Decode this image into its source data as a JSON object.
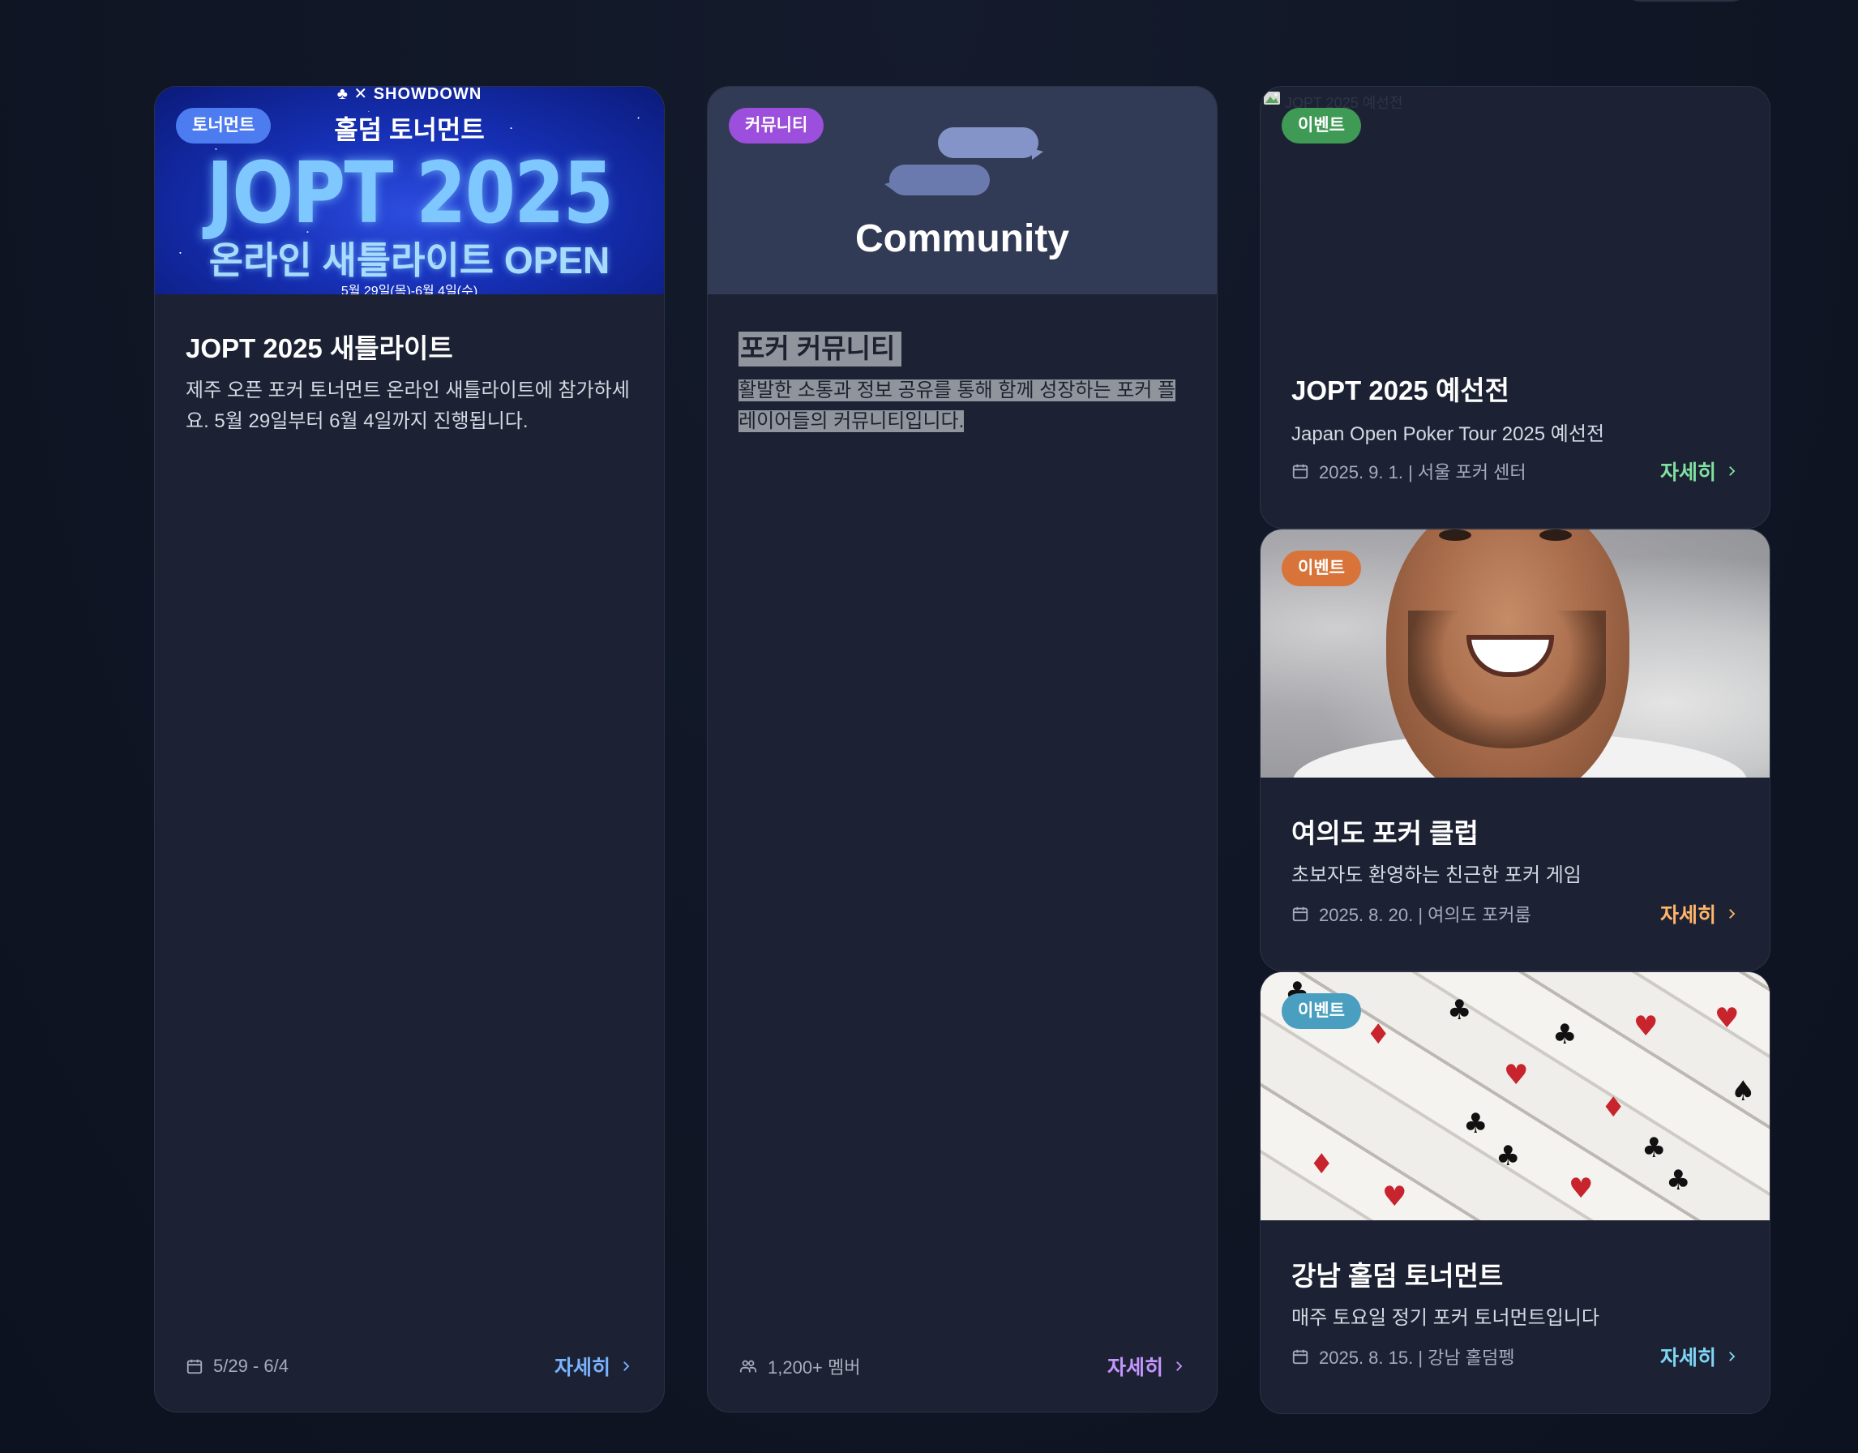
{
  "colors": {
    "tournament_badge": "#4d7cf0",
    "community_badge": "#9b4fdc",
    "event_badge_green": "#3f9a56",
    "event_badge_orange": "#d8743a",
    "event_badge_teal": "#4a9fc0",
    "more_blue": "#7ab3ff",
    "more_purple": "#c596ff",
    "more_green": "#7fe0a0",
    "more_orange": "#ffb56b",
    "more_cyan": "#7fd6f5"
  },
  "card_jopt": {
    "badge": "토너먼트",
    "banner": {
      "logo_text": "SHOWDOWN",
      "subtitle": "홀덤 토너먼트",
      "headline": "JOPT 2025",
      "tagline": "온라인 새틀라이트 OPEN",
      "date_line": "5월 29일(목)-6월 4일(수)"
    },
    "title": "JOPT 2025 새틀라이트",
    "description": "제주 오픈 포커 토너먼트 온라인 새틀라이트에 참가하세요. 5월 29일부터 6월 4일까지 진행됩니다.",
    "date": "5/29 - 6/4",
    "date_icon": "calendar-icon",
    "more": "자세히"
  },
  "card_community": {
    "badge": "커뮤니티",
    "banner_text": "Community",
    "title": "포커 커뮤니티",
    "description": "활발한 소통과 정보 공유를 통해 함께 성장하는 포커 플레이어들의 커뮤니티입니다.",
    "members": "1,200+ 멤버",
    "members_icon": "users-icon",
    "more": "자세히"
  },
  "event_cards": [
    {
      "badge": "이벤트",
      "image_alt": "JOPT 2025 예선전",
      "title": "JOPT 2025 예선전",
      "description": "Japan Open Poker Tour 2025 예선전",
      "meta": "2025. 9. 1. | 서울 포커 센터",
      "more": "자세히"
    },
    {
      "badge": "이벤트",
      "title": "여의도 포커 클럽",
      "description": "초보자도 환영하는 친근한 포커 게임",
      "meta": "2025. 8. 20. | 여의도 포커룸",
      "more": "자세히"
    },
    {
      "badge": "이벤트",
      "title": "강남 홀덤 토너먼트",
      "description": "매주 토요일 정기 포커 토너먼트입니다",
      "meta": "2025. 8. 15. | 강남 홀덤펭",
      "more": "자세히"
    }
  ]
}
